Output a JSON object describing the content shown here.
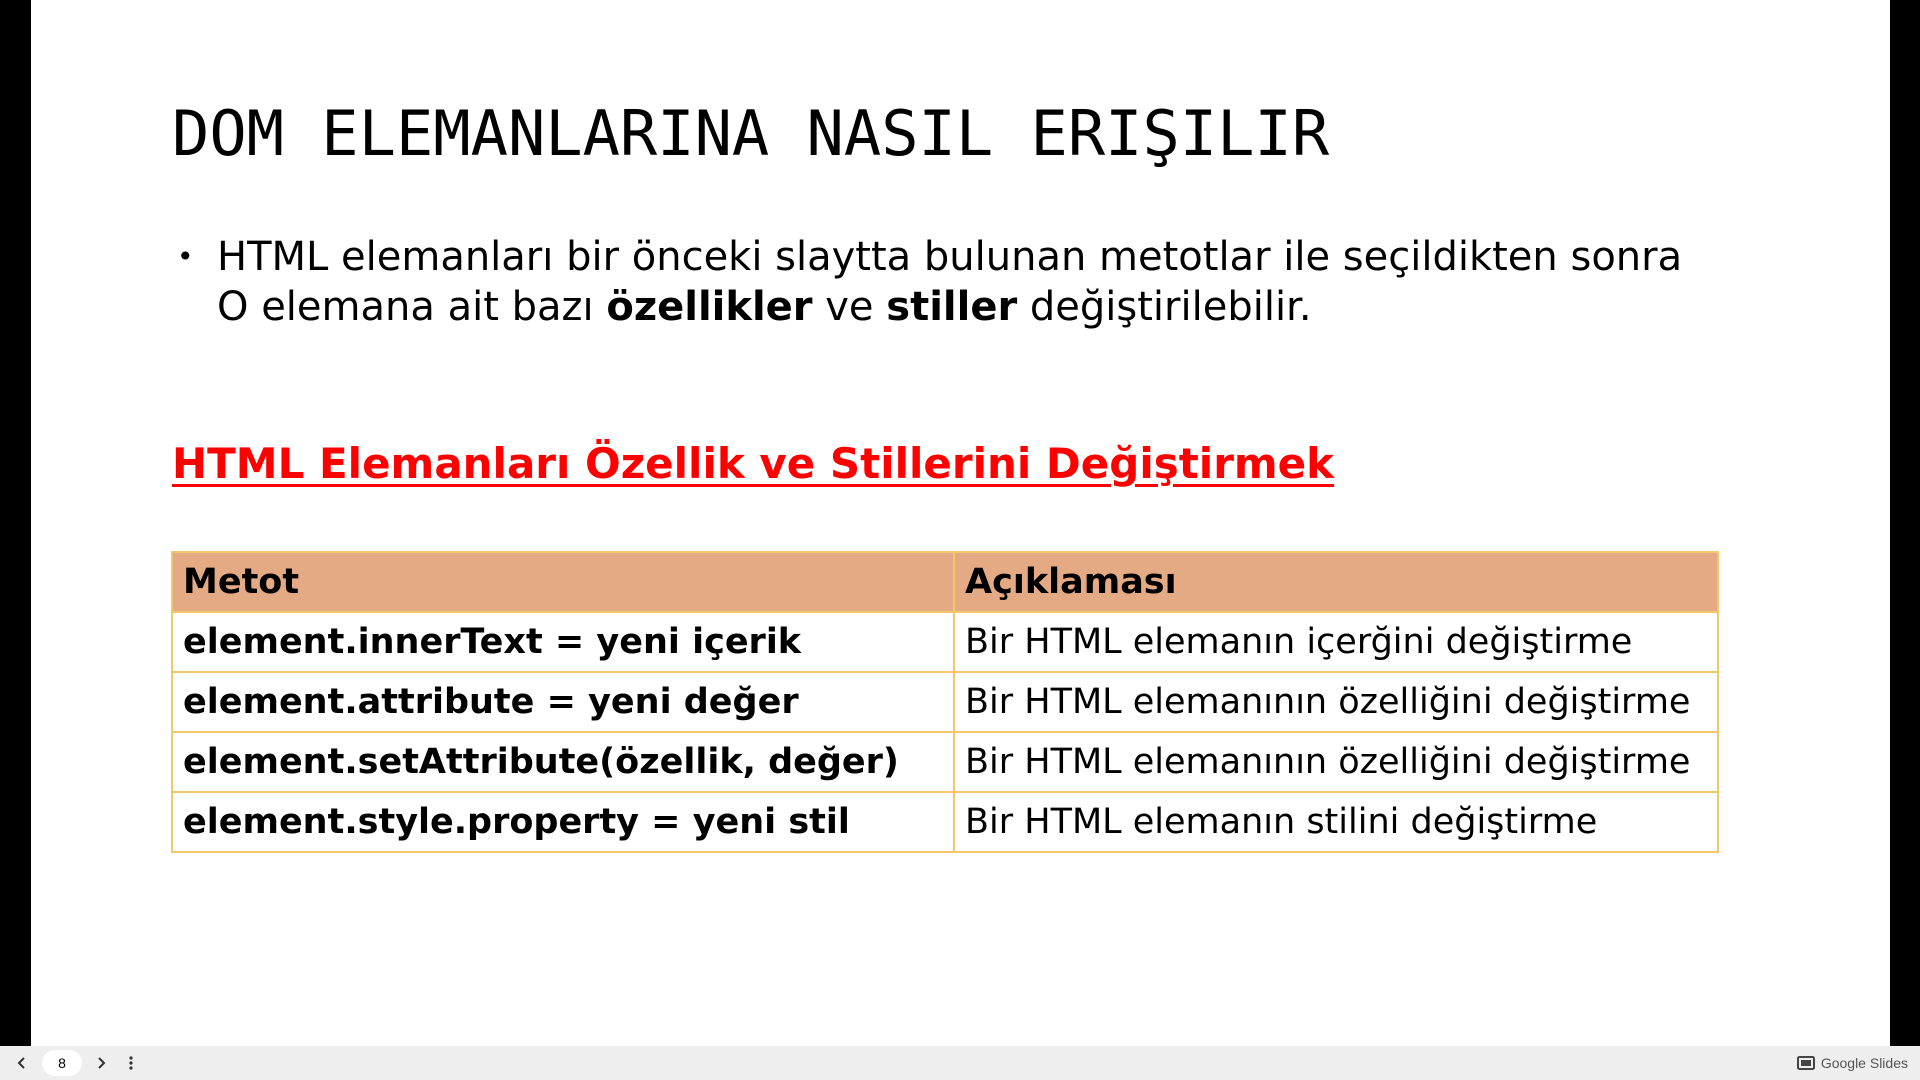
{
  "slide": {
    "title": "DOM ELEMANLARINA NASIL ERIŞILIR",
    "bullet": {
      "marker": "•",
      "line1": "HTML elemanları bir önceki slaytta bulunan metotlar ile seçildikten sonra",
      "line2_part1": "O elemana ait bazı ",
      "line2_bold1": "özellikler",
      "line2_part2": " ve ",
      "line2_bold2": "stiller",
      "line2_part3": " değiştirilebilir."
    },
    "section_heading": "HTML Elemanları Özellik ve Stillerini Değiştirmek",
    "table": {
      "headers": [
        "Metot",
        "Açıklaması"
      ],
      "rows": [
        [
          "element.innerText =  yeni içerik",
          "Bir HTML elemanın içerğini değiştirme"
        ],
        [
          "element.attribute = yeni değer",
          "Bir HTML elemanının özelliğini değiştirme"
        ],
        [
          "element.setAttribute(özellik, değer)",
          "Bir HTML elemanının özelliğini değiştirme"
        ],
        [
          "element.style.property = yeni stil",
          "Bir HTML elemanın stilini değiştirme"
        ]
      ]
    }
  },
  "toolbar": {
    "page_number": "8",
    "brand_label": "Google Slides",
    "icons": {
      "prev": "chevron-left-icon",
      "next": "chevron-right-icon",
      "menu": "more-vertical-icon",
      "brand": "slides-icon"
    }
  },
  "colors": {
    "heading_red": "#ff0000",
    "table_header_bg": "#e4aa84",
    "table_border": "#f3c76b"
  }
}
